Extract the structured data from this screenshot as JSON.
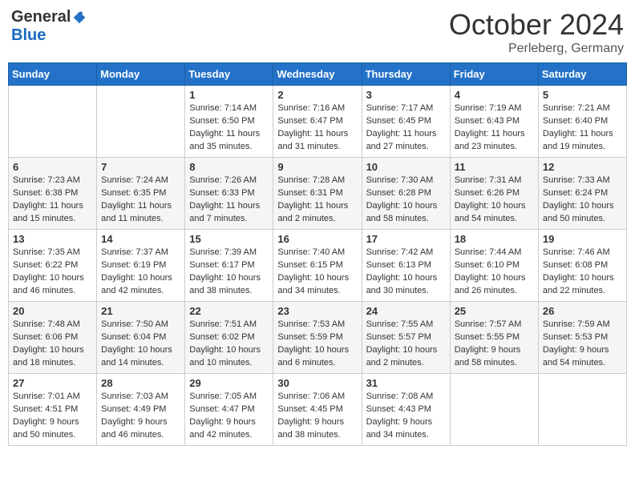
{
  "header": {
    "logo_general": "General",
    "logo_blue": "Blue",
    "title": "October 2024",
    "location": "Perleberg, Germany"
  },
  "days_of_week": [
    "Sunday",
    "Monday",
    "Tuesday",
    "Wednesday",
    "Thursday",
    "Friday",
    "Saturday"
  ],
  "weeks": [
    [
      {
        "num": "",
        "detail": ""
      },
      {
        "num": "",
        "detail": ""
      },
      {
        "num": "1",
        "detail": "Sunrise: 7:14 AM\nSunset: 6:50 PM\nDaylight: 11 hours and 35 minutes."
      },
      {
        "num": "2",
        "detail": "Sunrise: 7:16 AM\nSunset: 6:47 PM\nDaylight: 11 hours and 31 minutes."
      },
      {
        "num": "3",
        "detail": "Sunrise: 7:17 AM\nSunset: 6:45 PM\nDaylight: 11 hours and 27 minutes."
      },
      {
        "num": "4",
        "detail": "Sunrise: 7:19 AM\nSunset: 6:43 PM\nDaylight: 11 hours and 23 minutes."
      },
      {
        "num": "5",
        "detail": "Sunrise: 7:21 AM\nSunset: 6:40 PM\nDaylight: 11 hours and 19 minutes."
      }
    ],
    [
      {
        "num": "6",
        "detail": "Sunrise: 7:23 AM\nSunset: 6:38 PM\nDaylight: 11 hours and 15 minutes."
      },
      {
        "num": "7",
        "detail": "Sunrise: 7:24 AM\nSunset: 6:35 PM\nDaylight: 11 hours and 11 minutes."
      },
      {
        "num": "8",
        "detail": "Sunrise: 7:26 AM\nSunset: 6:33 PM\nDaylight: 11 hours and 7 minutes."
      },
      {
        "num": "9",
        "detail": "Sunrise: 7:28 AM\nSunset: 6:31 PM\nDaylight: 11 hours and 2 minutes."
      },
      {
        "num": "10",
        "detail": "Sunrise: 7:30 AM\nSunset: 6:28 PM\nDaylight: 10 hours and 58 minutes."
      },
      {
        "num": "11",
        "detail": "Sunrise: 7:31 AM\nSunset: 6:26 PM\nDaylight: 10 hours and 54 minutes."
      },
      {
        "num": "12",
        "detail": "Sunrise: 7:33 AM\nSunset: 6:24 PM\nDaylight: 10 hours and 50 minutes."
      }
    ],
    [
      {
        "num": "13",
        "detail": "Sunrise: 7:35 AM\nSunset: 6:22 PM\nDaylight: 10 hours and 46 minutes."
      },
      {
        "num": "14",
        "detail": "Sunrise: 7:37 AM\nSunset: 6:19 PM\nDaylight: 10 hours and 42 minutes."
      },
      {
        "num": "15",
        "detail": "Sunrise: 7:39 AM\nSunset: 6:17 PM\nDaylight: 10 hours and 38 minutes."
      },
      {
        "num": "16",
        "detail": "Sunrise: 7:40 AM\nSunset: 6:15 PM\nDaylight: 10 hours and 34 minutes."
      },
      {
        "num": "17",
        "detail": "Sunrise: 7:42 AM\nSunset: 6:13 PM\nDaylight: 10 hours and 30 minutes."
      },
      {
        "num": "18",
        "detail": "Sunrise: 7:44 AM\nSunset: 6:10 PM\nDaylight: 10 hours and 26 minutes."
      },
      {
        "num": "19",
        "detail": "Sunrise: 7:46 AM\nSunset: 6:08 PM\nDaylight: 10 hours and 22 minutes."
      }
    ],
    [
      {
        "num": "20",
        "detail": "Sunrise: 7:48 AM\nSunset: 6:06 PM\nDaylight: 10 hours and 18 minutes."
      },
      {
        "num": "21",
        "detail": "Sunrise: 7:50 AM\nSunset: 6:04 PM\nDaylight: 10 hours and 14 minutes."
      },
      {
        "num": "22",
        "detail": "Sunrise: 7:51 AM\nSunset: 6:02 PM\nDaylight: 10 hours and 10 minutes."
      },
      {
        "num": "23",
        "detail": "Sunrise: 7:53 AM\nSunset: 5:59 PM\nDaylight: 10 hours and 6 minutes."
      },
      {
        "num": "24",
        "detail": "Sunrise: 7:55 AM\nSunset: 5:57 PM\nDaylight: 10 hours and 2 minutes."
      },
      {
        "num": "25",
        "detail": "Sunrise: 7:57 AM\nSunset: 5:55 PM\nDaylight: 9 hours and 58 minutes."
      },
      {
        "num": "26",
        "detail": "Sunrise: 7:59 AM\nSunset: 5:53 PM\nDaylight: 9 hours and 54 minutes."
      }
    ],
    [
      {
        "num": "27",
        "detail": "Sunrise: 7:01 AM\nSunset: 4:51 PM\nDaylight: 9 hours and 50 minutes."
      },
      {
        "num": "28",
        "detail": "Sunrise: 7:03 AM\nSunset: 4:49 PM\nDaylight: 9 hours and 46 minutes."
      },
      {
        "num": "29",
        "detail": "Sunrise: 7:05 AM\nSunset: 4:47 PM\nDaylight: 9 hours and 42 minutes."
      },
      {
        "num": "30",
        "detail": "Sunrise: 7:06 AM\nSunset: 4:45 PM\nDaylight: 9 hours and 38 minutes."
      },
      {
        "num": "31",
        "detail": "Sunrise: 7:08 AM\nSunset: 4:43 PM\nDaylight: 9 hours and 34 minutes."
      },
      {
        "num": "",
        "detail": ""
      },
      {
        "num": "",
        "detail": ""
      }
    ]
  ]
}
